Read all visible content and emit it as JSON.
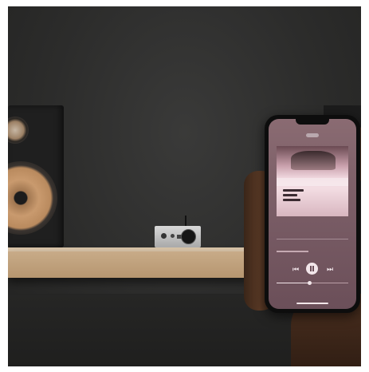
{
  "scene": {
    "subject": "",
    "colors": {
      "wall": "#2c2c2b",
      "shelf": "#c8ab88",
      "speaker_cone": "#c99a6e",
      "screen": "#7a5d66"
    }
  },
  "phone": {
    "status_time": "",
    "track_title": "",
    "volume_level": 0.45,
    "controls": {
      "prev_icon": "⏮",
      "next_icon": "⏭"
    }
  }
}
